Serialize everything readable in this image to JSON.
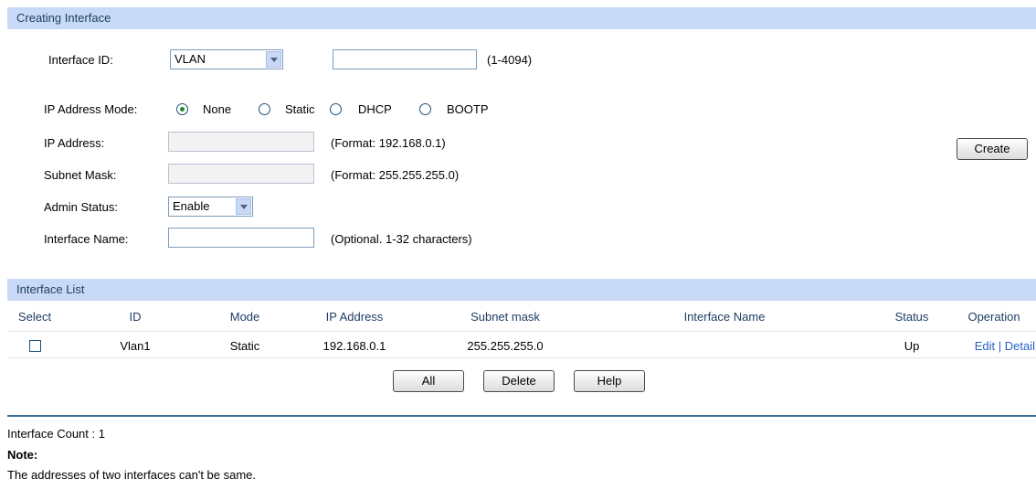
{
  "creating": {
    "header": "Creating Interface",
    "interface_id_label": "Interface ID:",
    "interface_id_type": "VLAN",
    "interface_id_value": "",
    "interface_id_range": "(1-4094)",
    "ip_mode_label": "IP Address Mode:",
    "ip_modes": [
      "None",
      "Static",
      "DHCP",
      "BOOTP"
    ],
    "ip_mode_selected": "None",
    "ip_address_label": "IP Address:",
    "ip_address_hint": "(Format: 192.168.0.1)",
    "subnet_label": "Subnet Mask:",
    "subnet_hint": "(Format: 255.255.255.0)",
    "admin_status_label": "Admin Status:",
    "admin_status_value": "Enable",
    "interface_name_label": "Interface Name:",
    "interface_name_hint": "(Optional. 1-32 characters)",
    "create_button": "Create"
  },
  "list": {
    "header": "Interface List",
    "columns": [
      "Select",
      "ID",
      "Mode",
      "IP Address",
      "Subnet mask",
      "Interface Name",
      "Status",
      "Operation"
    ],
    "rows": [
      {
        "selected": false,
        "id": "Vlan1",
        "mode": "Static",
        "ip": "192.168.0.1",
        "mask": "255.255.255.0",
        "name": "",
        "status": "Up",
        "edit": "Edit",
        "separator": "|",
        "detail": "Detail"
      }
    ],
    "buttons": {
      "all": "All",
      "delete": "Delete",
      "help": "Help"
    }
  },
  "footer": {
    "count_text": "Interface Count : 1",
    "note_title": "Note:",
    "note_text": "The addresses of two interfaces can't be same."
  },
  "colors": {
    "header_bg": "#c8daf6",
    "header_text": "#1f3e63",
    "divider": "#3a6d98",
    "link": "#2a62c4"
  }
}
